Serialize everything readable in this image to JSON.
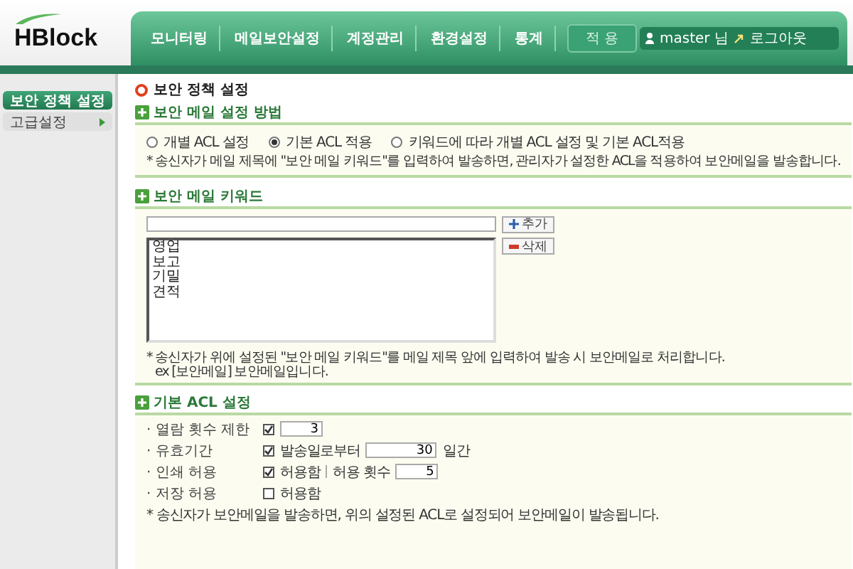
{
  "logo": "HBlock",
  "nav": [
    {
      "label": "모니터링",
      "selected": false
    },
    {
      "label": "메일보안설정",
      "selected": false
    },
    {
      "label": "계정관리",
      "selected": false
    },
    {
      "label": "환경설정",
      "selected": false
    },
    {
      "label": "통계",
      "selected": false
    }
  ],
  "apply_button": "적 용",
  "user": {
    "name": "master 님",
    "logout": "로그아웃"
  },
  "sidebar": {
    "items": [
      {
        "label": "보안 정책 설정",
        "selected": true
      },
      {
        "label": "고급설정",
        "selected": false
      }
    ]
  },
  "page_title": "보안 정책 설정",
  "method": {
    "title": "보안 메일 설정 방법",
    "options": [
      {
        "label": "개별 ACL 설정",
        "selected": false
      },
      {
        "label": "기본 ACL 적용",
        "selected": true
      },
      {
        "label": "키워드에 따라 개별 ACL 설정 및 기본 ACL적용",
        "selected": false
      }
    ],
    "note": "* 송신자가 메일 제목에 \"보안 메일 키워드\"를 입력하여 발송하면, 관리자가 설정한 ACL을 적용하여 보안메일을 발송합니다."
  },
  "keywords": {
    "title": "보안 메일 키워드",
    "add_button": "추가",
    "delete_button": "삭제",
    "items": [
      "영업",
      "보고",
      "기밀",
      "견적"
    ],
    "notes": [
      "* 송신자가 위에 설정된 \"보안 메일 키워드\"를 메일 제목 앞에 입력하여 발송 시 보안메일로 처리합니다.",
      "ex [보안메일] 보안메일입니다."
    ]
  },
  "acl": {
    "title": "기본 ACL 설정",
    "rows": [
      {
        "label": "· 열람 횟수 제한",
        "checked": true,
        "parts": [
          {
            "kind": "input",
            "value": "3"
          }
        ]
      },
      {
        "label": "· 유효기간",
        "checked": true,
        "parts": [
          {
            "kind": "text",
            "text": "발송일로부터"
          },
          {
            "kind": "input",
            "value": "30"
          },
          {
            "kind": "text",
            "text": "일간"
          }
        ]
      },
      {
        "label": "· 인쇄 허용",
        "checked": true,
        "parts": [
          {
            "kind": "text",
            "text": "허용함"
          },
          {
            "kind": "divider"
          },
          {
            "kind": "text",
            "text": "허용 횟수"
          },
          {
            "kind": "input",
            "value": "5"
          }
        ]
      },
      {
        "label": "· 저장 허용",
        "checked": false,
        "parts": [
          {
            "kind": "text",
            "text": "허용함"
          }
        ]
      }
    ],
    "note": "* 송신자가 보안메일을 발송하면, 위의 설정된 ACL로 설정되어 보안메일이 발송됩니다."
  }
}
